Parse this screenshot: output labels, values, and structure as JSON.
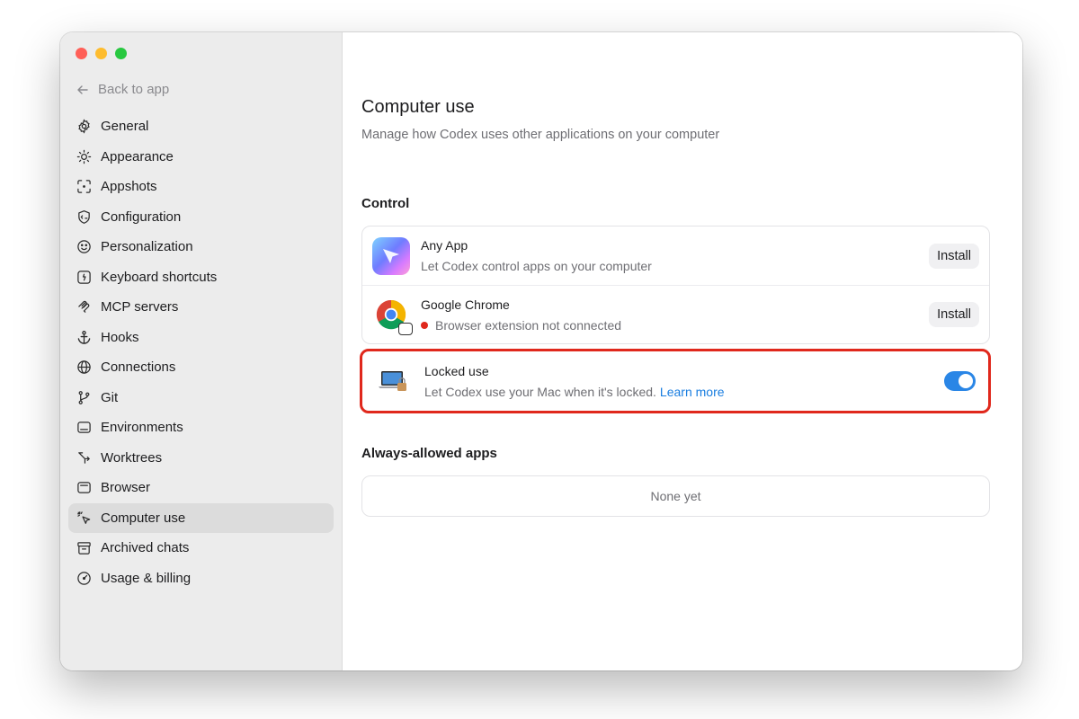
{
  "window": {
    "traffic_colors": [
      "#ff5f57",
      "#febc2e",
      "#28c840"
    ]
  },
  "sidebar": {
    "back_label": "Back to app",
    "items": [
      {
        "label": "General",
        "icon": "gear-icon"
      },
      {
        "label": "Appearance",
        "icon": "sun-icon"
      },
      {
        "label": "Appshots",
        "icon": "screenshot-frame-icon"
      },
      {
        "label": "Configuration",
        "icon": "shield-code-icon"
      },
      {
        "label": "Personalization",
        "icon": "smile-icon"
      },
      {
        "label": "Keyboard shortcuts",
        "icon": "command-key-icon"
      },
      {
        "label": "MCP servers",
        "icon": "mcp-icon"
      },
      {
        "label": "Hooks",
        "icon": "anchor-icon"
      },
      {
        "label": "Connections",
        "icon": "globe-icon"
      },
      {
        "label": "Git",
        "icon": "git-branch-icon"
      },
      {
        "label": "Environments",
        "icon": "terminal-box-icon"
      },
      {
        "label": "Worktrees",
        "icon": "worktree-icon"
      },
      {
        "label": "Browser",
        "icon": "browser-window-icon"
      },
      {
        "label": "Computer use",
        "icon": "cursor-click-icon",
        "active": true
      },
      {
        "label": "Archived chats",
        "icon": "archive-box-icon"
      },
      {
        "label": "Usage & billing",
        "icon": "gauge-icon"
      }
    ]
  },
  "main": {
    "title": "Computer use",
    "subtitle": "Manage how Codex uses other applications on your computer",
    "control": {
      "heading": "Control",
      "rows": [
        {
          "title": "Any App",
          "description": "Let Codex control apps on your computer",
          "button": "Install",
          "icon": "any-app-icon"
        },
        {
          "title": "Google Chrome",
          "description": "Browser extension not connected",
          "button": "Install",
          "icon": "chrome-icon",
          "status_color": "#e0281c"
        }
      ]
    },
    "locked": {
      "title": "Locked use",
      "description": "Let Codex use your Mac when it's locked.",
      "link": "Learn more",
      "enabled": true,
      "accent": "#2a86e6",
      "highlight": "#e0281c"
    },
    "always_allowed": {
      "heading": "Always-allowed apps",
      "empty_text": "None yet"
    }
  }
}
